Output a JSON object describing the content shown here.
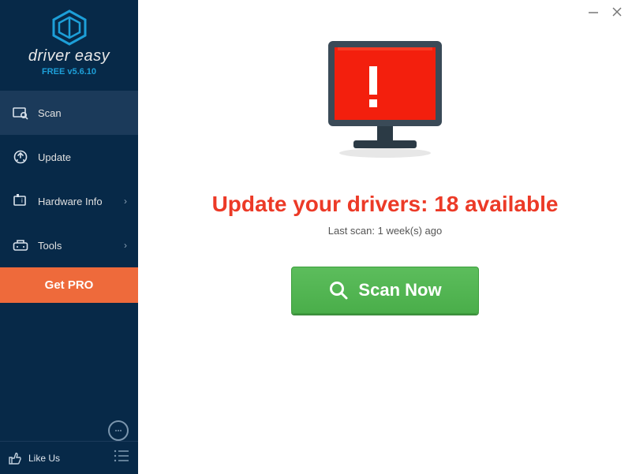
{
  "app": {
    "name": "driver easy",
    "version": "FREE v5.6.10"
  },
  "sidebar": {
    "items": [
      {
        "label": "Scan",
        "icon": "scan",
        "active": true,
        "hasChevron": false
      },
      {
        "label": "Update",
        "icon": "update",
        "active": false,
        "hasChevron": false
      },
      {
        "label": "Hardware Info",
        "icon": "hardware",
        "active": false,
        "hasChevron": true
      },
      {
        "label": "Tools",
        "icon": "tools",
        "active": false,
        "hasChevron": true
      }
    ],
    "getPro": "Get PRO",
    "likeUs": "Like Us"
  },
  "main": {
    "headline": "Update your drivers: 18 available",
    "subline": "Last scan: 1 week(s) ago",
    "scanButton": "Scan Now"
  }
}
